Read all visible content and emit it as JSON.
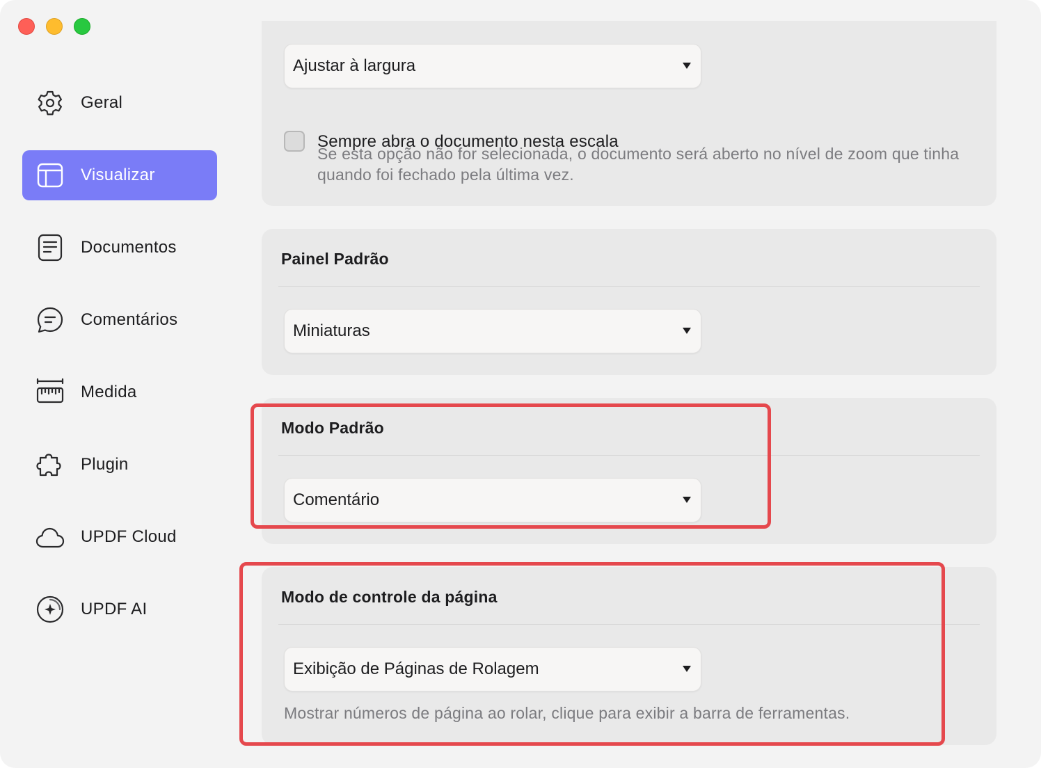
{
  "window": {
    "traffic_lights": [
      "close",
      "minimize",
      "zoom"
    ]
  },
  "sidebar": {
    "items": [
      {
        "label": "Geral",
        "icon": "gear-icon",
        "active": false
      },
      {
        "label": "Visualizar",
        "icon": "layout-icon",
        "active": true
      },
      {
        "label": "Documentos",
        "icon": "document-icon",
        "active": false
      },
      {
        "label": "Comentários",
        "icon": "comment-icon",
        "active": false
      },
      {
        "label": "Medida",
        "icon": "ruler-icon",
        "active": false
      },
      {
        "label": "Plugin",
        "icon": "puzzle-icon",
        "active": false
      },
      {
        "label": "UPDF Cloud",
        "icon": "cloud-icon",
        "active": false
      },
      {
        "label": "UPDF AI",
        "icon": "ai-sparkle-icon",
        "active": false
      }
    ]
  },
  "zoom_section": {
    "select_value": "Ajustar à largura",
    "checkbox_label": "Sempre abra o documento nesta escala",
    "checkbox_checked": false,
    "description": "Se esta opção não for selecionada, o documento será aberto no nível de zoom que tinha quando foi fechado pela última vez."
  },
  "panel_section": {
    "title": "Painel Padrão",
    "select_value": "Miniaturas"
  },
  "mode_section": {
    "title": "Modo Padrão",
    "select_value": "Comentário"
  },
  "page_control_section": {
    "title": "Modo de controle da página",
    "select_value": "Exibição de Páginas de Rolagem",
    "description": "Mostrar números de página ao rolar, clique para exibir a barra de ferramentas."
  },
  "colors": {
    "accent": "#7a7cf7",
    "highlight": "#e5484d",
    "window_bg": "#f3f3f3",
    "card_bg": "#e9e9e9"
  }
}
